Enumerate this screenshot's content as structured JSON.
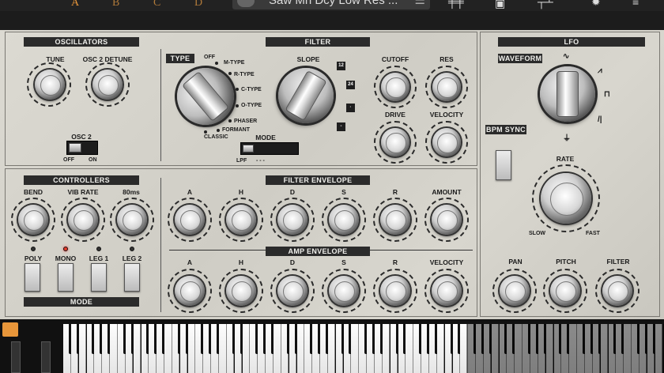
{
  "topbar": {
    "slots": [
      "A",
      "B",
      "C",
      "D"
    ],
    "preset_name": "Saw Mn Dcy Low Res ...",
    "icons": [
      "mixer-sliders-icon",
      "camera-icon",
      "network-icon",
      "settings-gear-icon"
    ]
  },
  "oscillators": {
    "title": "OSCILLATORS",
    "tune_label": "TUNE",
    "detune_label": "OSC 2 DETUNE",
    "osc2_label": "OSC 2",
    "off_label": "OFF",
    "on_label": "ON"
  },
  "filter": {
    "title": "FILTER",
    "type_label": "TYPE",
    "types": [
      "OFF",
      "M-TYPE",
      "R-TYPE",
      "C-TYPE",
      "O-TYPE",
      "PHASER",
      "FORMANT",
      "CLASSIC"
    ],
    "slope_label": "SLOPE",
    "slopes": [
      "12",
      "24",
      "·",
      "-"
    ],
    "mode_label": "MODE",
    "mode_lpf": "LPF",
    "mode_dashes": "-   -   -",
    "cutoff_label": "CUTOFF",
    "res_label": "RES",
    "drive_label": "DRIVE",
    "velocity_label": "VELOCITY"
  },
  "lfo": {
    "title": "LFO",
    "waveform_label": "WAVEFORM",
    "bpm_sync_label": "BPM SYNC",
    "rate_label": "RATE",
    "slow_label": "SLOW",
    "fast_label": "FAST",
    "pan_label": "PAN",
    "pitch_label": "PITCH",
    "filter_label": "FILTER"
  },
  "controllers": {
    "title": "CONTROLLERS",
    "bend_label": "BEND",
    "vib_rate_label": "VIB RATE",
    "time_label": "80ms",
    "modes": [
      {
        "label": "POLY",
        "active": false
      },
      {
        "label": "MONO",
        "active": true
      },
      {
        "label": "LEG 1",
        "active": false
      },
      {
        "label": "LEG 2",
        "active": false
      }
    ],
    "mode_title": "MODE"
  },
  "filter_envelope": {
    "title": "FILTER ENVELOPE",
    "labels": [
      "A",
      "H",
      "D",
      "S",
      "R",
      "AMOUNT"
    ]
  },
  "amp_envelope": {
    "title": "AMP ENVELOPE",
    "labels": [
      "A",
      "H",
      "D",
      "S",
      "R",
      "VELOCITY"
    ]
  },
  "colors": {
    "panel": "#d6d4cc",
    "header": "#2b2b2b",
    "accent": "#e8963a",
    "led_on": "#e53a2a"
  }
}
